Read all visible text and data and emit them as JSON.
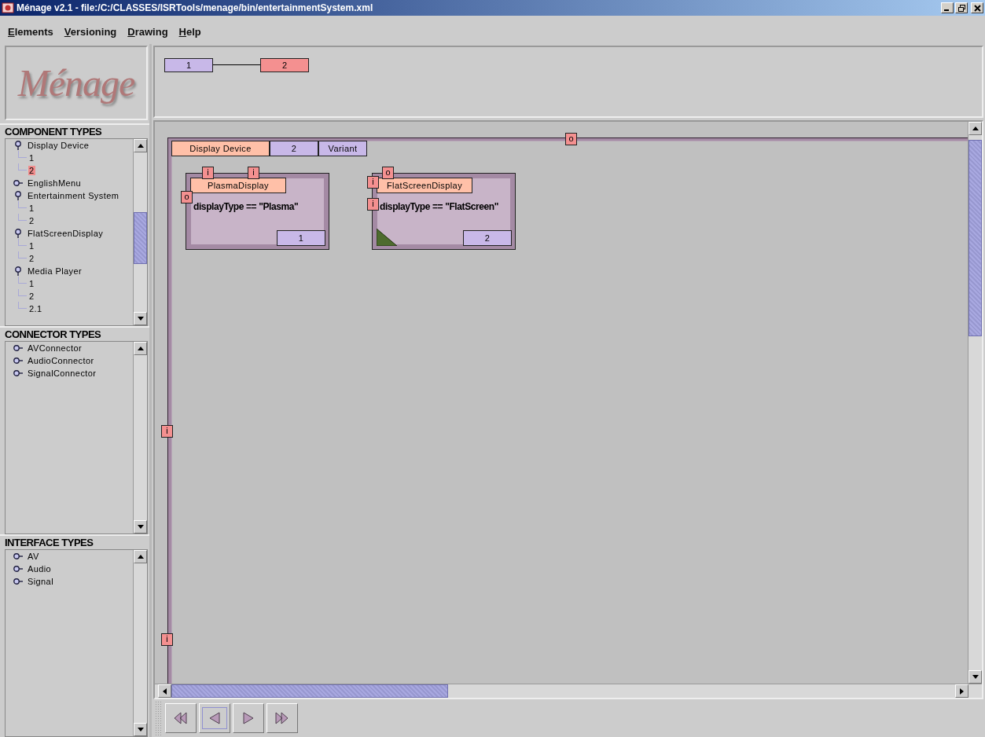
{
  "window": {
    "title": "Ménage v2.1 - file:/C:/CLASSES/ISRTools/menage/bin/entertainmentSystem.xml"
  },
  "menu": [
    {
      "label": "Elements"
    },
    {
      "label": "Versioning"
    },
    {
      "label": "Drawing"
    },
    {
      "label": "Help"
    }
  ],
  "logo": {
    "text": "Ménage"
  },
  "version_graph": {
    "nodes": [
      {
        "label": "1",
        "selected": false
      },
      {
        "label": "2",
        "selected": true
      }
    ]
  },
  "component_types": {
    "title": "COMPONENT TYPES",
    "items": [
      {
        "label": "Display Device",
        "expanded": true,
        "children": [
          {
            "label": "1",
            "selected": false
          },
          {
            "label": "2",
            "selected": true
          }
        ]
      },
      {
        "label": "EnglishMenu",
        "expanded": false
      },
      {
        "label": "Entertainment System",
        "expanded": true,
        "children": [
          {
            "label": "1",
            "selected": false
          },
          {
            "label": "2",
            "selected": false
          }
        ]
      },
      {
        "label": "FlatScreenDisplay",
        "expanded": true,
        "children": [
          {
            "label": "1",
            "selected": false
          },
          {
            "label": "2",
            "selected": false
          }
        ]
      },
      {
        "label": "Media Player",
        "expanded": true,
        "children": [
          {
            "label": "1",
            "selected": false
          },
          {
            "label": "2",
            "selected": false
          },
          {
            "label": "2.1",
            "selected": false
          }
        ]
      }
    ]
  },
  "connector_types": {
    "title": "CONNECTOR TYPES",
    "items": [
      {
        "label": "AVConnector",
        "expanded": false
      },
      {
        "label": "AudioConnector",
        "expanded": false
      },
      {
        "label": "SignalConnector",
        "expanded": false
      }
    ]
  },
  "interface_types": {
    "title": "INTERFACE TYPES",
    "items": [
      {
        "label": "AV",
        "expanded": false
      },
      {
        "label": "Audio",
        "expanded": false
      },
      {
        "label": "Signal",
        "expanded": false
      }
    ]
  },
  "canvas": {
    "frame": {
      "type": "Display Device",
      "version": "2",
      "role": "Variant"
    },
    "ports": [
      {
        "label": "o"
      },
      {
        "label": "i"
      },
      {
        "label": "i"
      }
    ],
    "components": [
      {
        "name": "PlasmaDisplay",
        "condition": "displayType == \"Plasma\"",
        "version": "1",
        "corner_mark": false,
        "ports": [
          {
            "label": "i"
          },
          {
            "label": "i"
          },
          {
            "label": "o"
          }
        ]
      },
      {
        "name": "FlatScreenDisplay",
        "condition": "displayType == \"FlatScreen\"",
        "version": "2",
        "corner_mark": true,
        "ports": [
          {
            "label": "o"
          },
          {
            "label": "i"
          },
          {
            "label": "i"
          }
        ]
      }
    ]
  },
  "playback_buttons": [
    {
      "kind": "first",
      "selected": false
    },
    {
      "kind": "previous",
      "selected": true
    },
    {
      "kind": "next",
      "selected": false
    },
    {
      "kind": "last",
      "selected": false
    }
  ]
}
